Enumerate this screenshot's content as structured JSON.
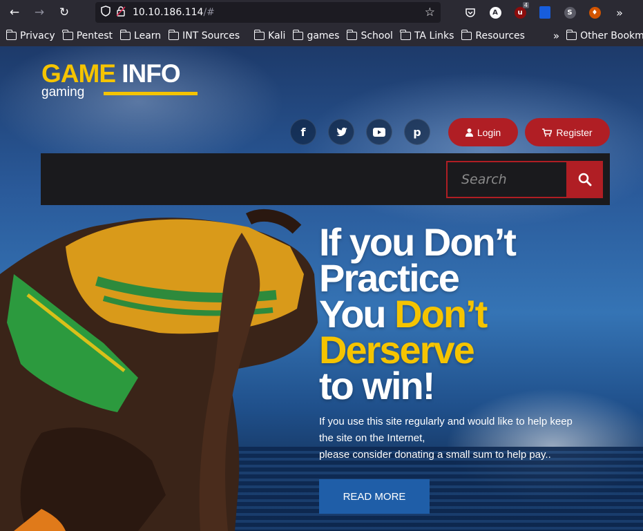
{
  "browser": {
    "url_host": "10.10.186.114",
    "url_rest": "/#",
    "bookmarks": [
      "Privacy",
      "Pentest",
      "Learn",
      "INT Sources",
      "Kali",
      "games",
      "School",
      "TA Links",
      "Resources"
    ],
    "other_bookmarks": "Other Bookmarks",
    "ext_badge": "4"
  },
  "site": {
    "logo_main_1": "GAME",
    "logo_main_2": "INFO",
    "logo_sub": "gaming",
    "login_label": "Login",
    "register_label": "Register",
    "search_placeholder": "Search",
    "headline": {
      "line1": "If you Don’t",
      "line2": "Practice",
      "line3a": "You",
      "line3b": "Don’t",
      "line4": "Derserve",
      "line5": "to win!"
    },
    "desc_line1": "If you use this site regularly and would like to help keep",
    "desc_line2": "the site on the Internet,",
    "desc_line3": "please consider donating a small sum to help pay..",
    "read_more": "READ MORE"
  },
  "colors": {
    "brand_yellow": "#f5c400",
    "accent_red": "#b01e24",
    "button_blue": "#1f5ea8"
  }
}
